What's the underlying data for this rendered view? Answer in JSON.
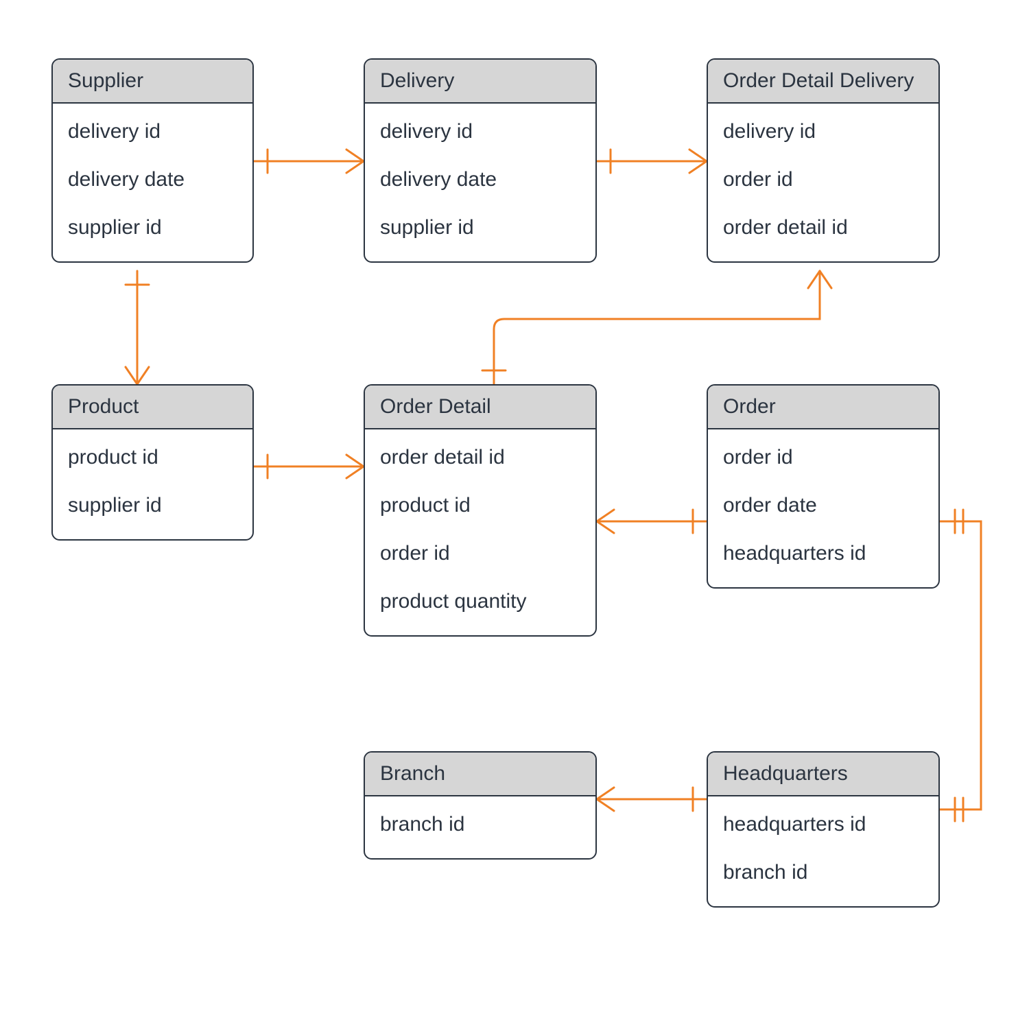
{
  "entities": {
    "supplier": {
      "title": "Supplier",
      "attrs": [
        "delivery id",
        "delivery date",
        "supplier id"
      ]
    },
    "delivery": {
      "title": "Delivery",
      "attrs": [
        "delivery id",
        "delivery date",
        "supplier id"
      ]
    },
    "orderDetailDelivery": {
      "title": "Order Detail Delivery",
      "attrs": [
        "delivery id",
        "order id",
        "order detail id"
      ]
    },
    "product": {
      "title": "Product",
      "attrs": [
        "product id",
        "supplier id"
      ]
    },
    "orderDetail": {
      "title": "Order Detail",
      "attrs": [
        "order detail id",
        "product id",
        "order id",
        "product quantity"
      ]
    },
    "order": {
      "title": "Order",
      "attrs": [
        "order id",
        "order date",
        "headquarters id"
      ]
    },
    "branch": {
      "title": "Branch",
      "attrs": [
        "branch id"
      ]
    },
    "headquarters": {
      "title": "Headquarters",
      "attrs": [
        "headquarters id",
        "branch id"
      ]
    }
  },
  "colors": {
    "connector": "#f08024",
    "entityBorder": "#2b3440",
    "entityHeader": "#d6d6d6"
  }
}
